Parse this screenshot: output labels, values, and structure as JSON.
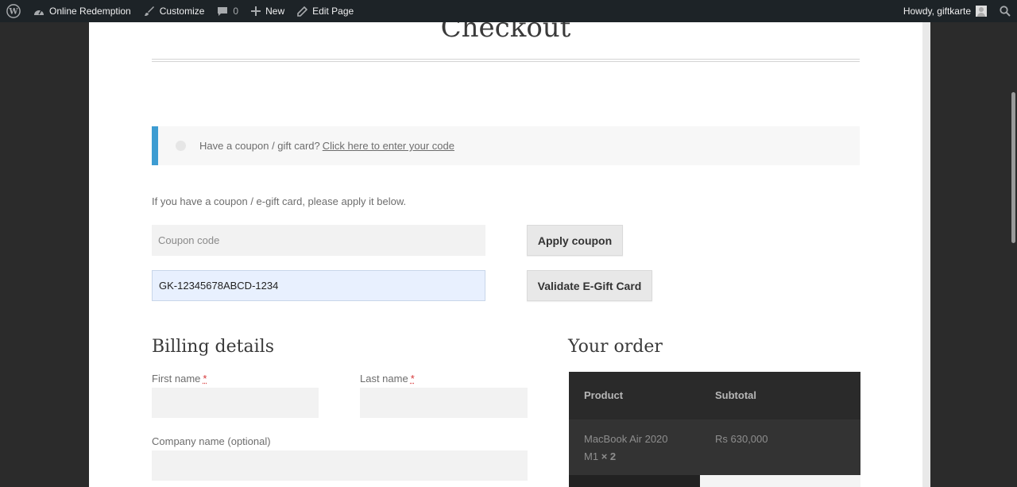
{
  "admin_bar": {
    "site_name": "Online Redemption",
    "customize": "Customize",
    "comments_count": "0",
    "new_label": "New",
    "edit_page": "Edit Page",
    "howdy": "Howdy, giftkarte"
  },
  "page": {
    "title": "Checkout"
  },
  "coupon_notice": {
    "text": "Have a coupon / gift card?",
    "link": "Click here to enter your code"
  },
  "coupon_form": {
    "hint": "If you have a coupon / e-gift card, please apply it below.",
    "coupon_placeholder": "Coupon code",
    "gift_card_value": "GK-12345678ABCD-1234",
    "apply_button": "Apply coupon",
    "validate_button": "Validate E-Gift Card"
  },
  "billing": {
    "heading": "Billing details",
    "first_name_label": "First name",
    "last_name_label": "Last name",
    "company_label": "Company name (optional)",
    "required_mark": "*"
  },
  "order": {
    "heading": "Your order",
    "col_product": "Product",
    "col_subtotal": "Subtotal",
    "item_name_line1": "MacBook Air 2020",
    "item_name_line2": "M1",
    "item_qty": "× 2",
    "item_subtotal": "Rs 630,000"
  },
  "colors": {
    "admin_bar_bg": "#1d2327",
    "notice_accent": "#3d9cd2",
    "autofill_bg": "#e8f0fe"
  }
}
